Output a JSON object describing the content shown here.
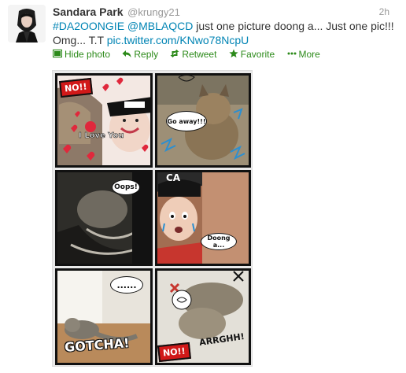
{
  "tweet": {
    "fullname": "Sandara Park",
    "username": "@krungy21",
    "time": "2h",
    "text": {
      "hashtag": "#DA2OONGIE",
      "mention": "@MBLAQCD",
      "middle": " just one picture doong a... Just one pic!!! Omg... T.T ",
      "link": "pic.twitter.com/KNwo78NcpU"
    },
    "actions": [
      {
        "label": "Hide photo",
        "icon": "photo-icon"
      },
      {
        "label": "Reply",
        "icon": "reply-icon"
      },
      {
        "label": "Retweet",
        "icon": "retweet-icon"
      },
      {
        "label": "Favorite",
        "icon": "star-icon"
      },
      {
        "label": "More",
        "icon": "more-icon"
      }
    ]
  },
  "media": {
    "panels": [
      {
        "bubble": "NO!!",
        "extra": "I Love You"
      },
      {
        "bubble": "Go away!!!"
      },
      {
        "bubble": "Oops!"
      },
      {
        "bubble": "Doong a..."
      },
      {
        "bubble": "......",
        "caption": "GOTCHA!"
      },
      {
        "bubble": "NO!!",
        "caption": "ARRGHH!"
      }
    ]
  },
  "colors": {
    "link": "#0084b4",
    "action": "#2c8a1a",
    "name": "#333333",
    "muted": "#999999"
  }
}
